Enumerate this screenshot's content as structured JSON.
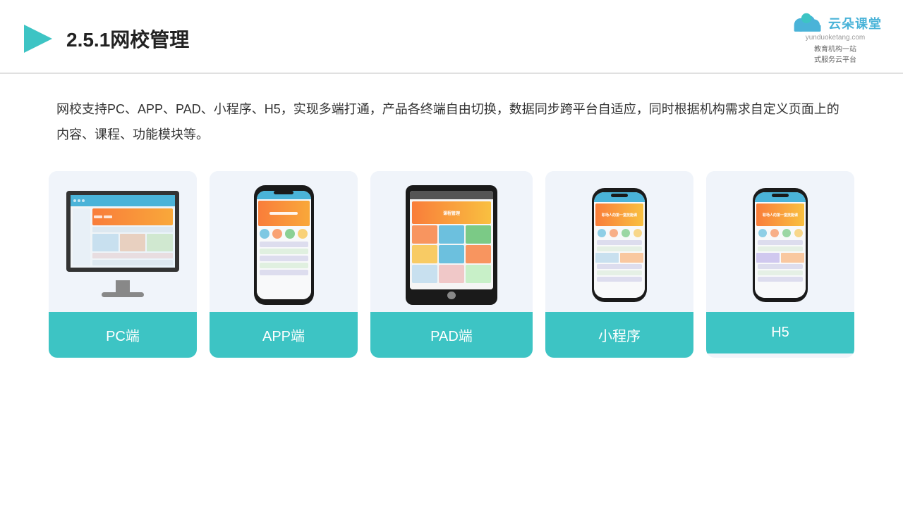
{
  "header": {
    "title": "2.5.1网校管理",
    "logo_name": "云朵课堂",
    "logo_url": "yunduoketang.com",
    "logo_tagline": "教育机构一站\n式服务云平台"
  },
  "description": {
    "text": "网校支持PC、APP、PAD、小程序、H5，实现多端打通，产品各终端自由切换，数据同步跨平台自适应，同时根据机构需求自定义页面上的内容、课程、功能模块等。"
  },
  "cards": [
    {
      "id": "pc",
      "label": "PC端"
    },
    {
      "id": "app",
      "label": "APP端"
    },
    {
      "id": "pad",
      "label": "PAD端"
    },
    {
      "id": "miniprogram",
      "label": "小程序"
    },
    {
      "id": "h5",
      "label": "H5"
    }
  ],
  "colors": {
    "teal": "#3dc4c4",
    "blue": "#4ab3d8",
    "accent": "#f97d3a",
    "bg_card": "#f0f4fa"
  }
}
